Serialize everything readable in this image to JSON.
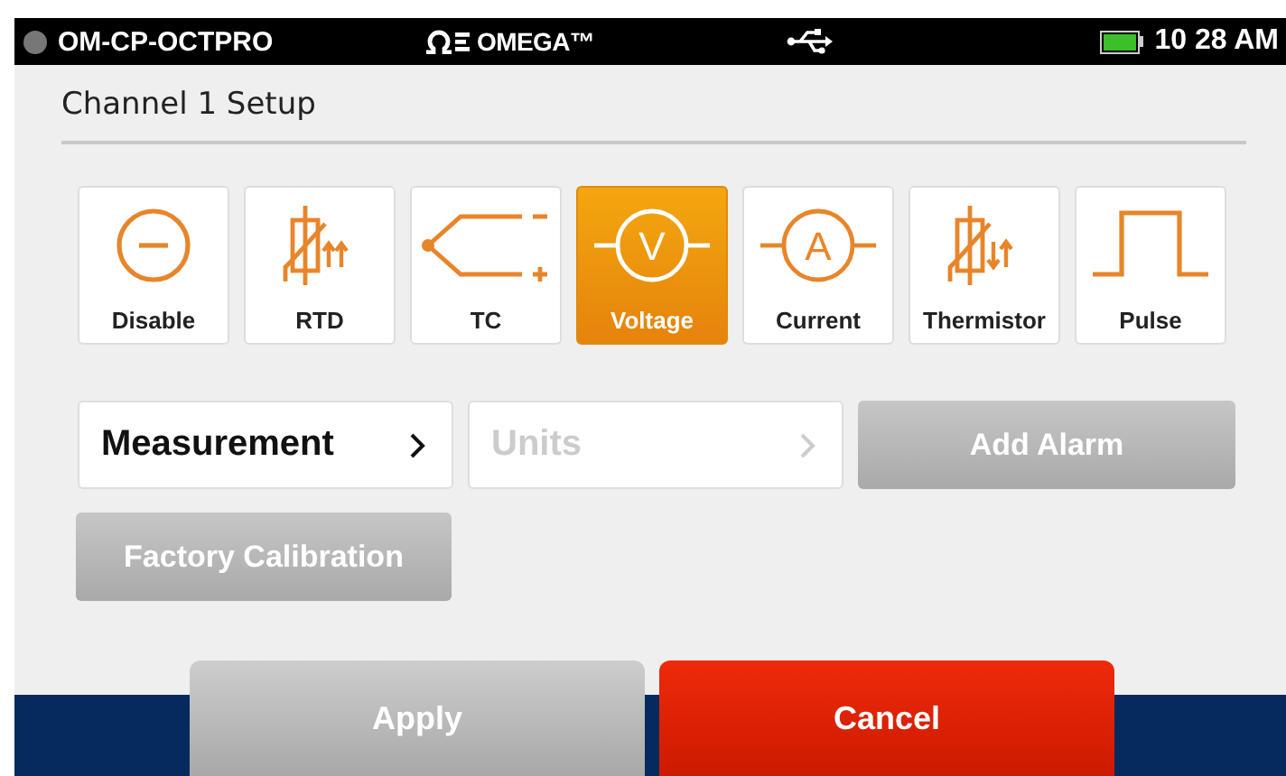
{
  "status_bar": {
    "device": "OM-CP-OCTPRO",
    "logo": "OMEGA™",
    "time": "10 28 AM"
  },
  "title": "Channel 1 Setup",
  "input_types": [
    {
      "kind": "disable",
      "label": "Disable",
      "selected": false
    },
    {
      "kind": "rtd",
      "label": "RTD",
      "selected": false
    },
    {
      "kind": "tc",
      "label": "TC",
      "selected": false
    },
    {
      "kind": "meter",
      "symbol": "V",
      "label": "Voltage",
      "selected": true
    },
    {
      "kind": "meter",
      "symbol": "A",
      "label": "Current",
      "selected": false
    },
    {
      "kind": "thermistor",
      "label": "Thermistor",
      "selected": false
    },
    {
      "kind": "pulse",
      "label": "Pulse",
      "selected": false
    }
  ],
  "selectors": [
    {
      "label": "Measurement",
      "disabled": false
    },
    {
      "label": "Units",
      "disabled": true
    }
  ],
  "add_alarm": {
    "label": "Add Alarm",
    "disabled": true
  },
  "factory_calibration": {
    "label": "Factory Calibration",
    "disabled": true
  },
  "footer_buttons": [
    {
      "label": "Apply",
      "kind": "apply",
      "disabled": true
    },
    {
      "label": "Cancel",
      "kind": "cancel",
      "disabled": false
    }
  ]
}
